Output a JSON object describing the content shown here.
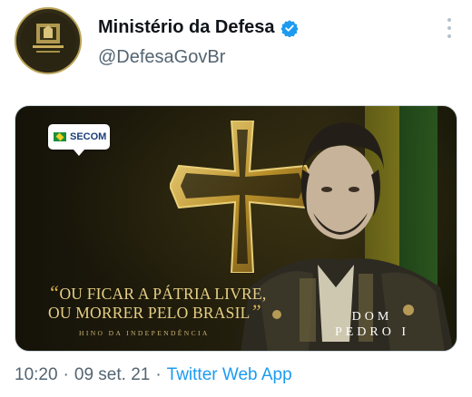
{
  "account": {
    "name": "Ministério da Defesa",
    "handle": "@DefesaGovBr",
    "verified": true,
    "avatar_icon": "ministry-emblem-icon"
  },
  "media": {
    "badge_text": "SECOM",
    "quote_line1": "OU FICAR A PÁTRIA LIVRE,",
    "quote_line2": "OU MORRER PELO BRASIL",
    "caption_small": "HINO DA INDEPENDÊNCIA",
    "name_line1": "DOM",
    "name_line2": "PEDRO I",
    "colors": {
      "gold": "#e6cf86",
      "dark": "#1c190c",
      "green": "#2c5e22",
      "yellow": "#8a841f"
    }
  },
  "footer": {
    "time": "10:20",
    "sep1": "·",
    "date": "09 set. 21",
    "sep2": "·",
    "source": "Twitter Web App"
  },
  "colors": {
    "link": "#1d9bf0",
    "muted": "#536471",
    "verified": "#1d9bf0"
  }
}
